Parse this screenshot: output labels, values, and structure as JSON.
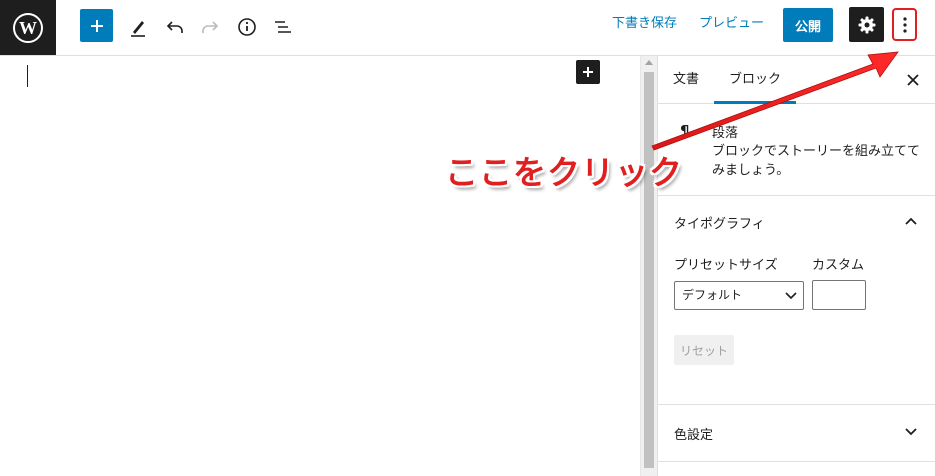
{
  "toolbar": {
    "save_draft": "下書き保存",
    "preview": "プレビュー",
    "publish": "公開"
  },
  "sidebar": {
    "tabs": [
      "文書",
      "ブロック"
    ],
    "block": {
      "title": "段落",
      "description": "ブロックでストーリーを組み立ててみましょう。"
    },
    "typography": {
      "title": "タイポグラフィ",
      "preset_label": "プリセットサイズ",
      "custom_label": "カスタム",
      "preset_value": "デフォルト",
      "reset_label": "リセット"
    },
    "color_settings": {
      "title": "色設定"
    }
  },
  "annotation": {
    "text": "ここをクリック",
    "color": "#e02020"
  },
  "colors": {
    "accent": "#007cba",
    "dark": "#1e1e1e"
  },
  "icons": [
    "wordpress-logo-icon",
    "plus-icon",
    "pencil-icon",
    "undo-icon",
    "redo-icon",
    "info-icon",
    "list-view-icon",
    "gear-icon",
    "more-vertical-icon",
    "close-icon",
    "pilcrow-icon",
    "chevron-up-icon",
    "chevron-down-icon"
  ]
}
